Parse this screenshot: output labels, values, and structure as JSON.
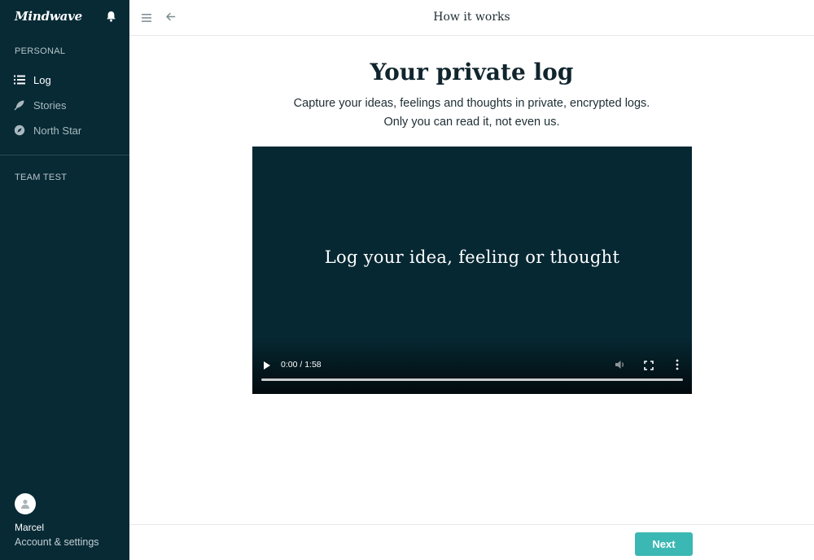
{
  "app": {
    "brand": "Mindwave"
  },
  "sidebar": {
    "personal_label": "PERSONAL",
    "items": [
      {
        "label": "Log",
        "icon": "list-icon",
        "active": true
      },
      {
        "label": "Stories",
        "icon": "feather-icon",
        "active": false
      },
      {
        "label": "North Star",
        "icon": "compass-icon",
        "active": false
      }
    ],
    "team_label": "TEAM TEST",
    "user": {
      "name": "Marcel",
      "settings_label": "Account & settings"
    }
  },
  "header": {
    "title": "How it works"
  },
  "main": {
    "title": "Your private log",
    "description_line1": "Capture your ideas, feelings and thoughts in private, encrypted logs.",
    "description_line2": "Only you can read it, not even us."
  },
  "video": {
    "caption": "Log your idea, feeling or thought",
    "time": "0:00 / 1:58",
    "progress": 0
  },
  "footer": {
    "next_label": "Next"
  },
  "colors": {
    "sidebar_bg": "#072a35",
    "video_bg": "#062833",
    "accent": "#3cb8b4"
  }
}
